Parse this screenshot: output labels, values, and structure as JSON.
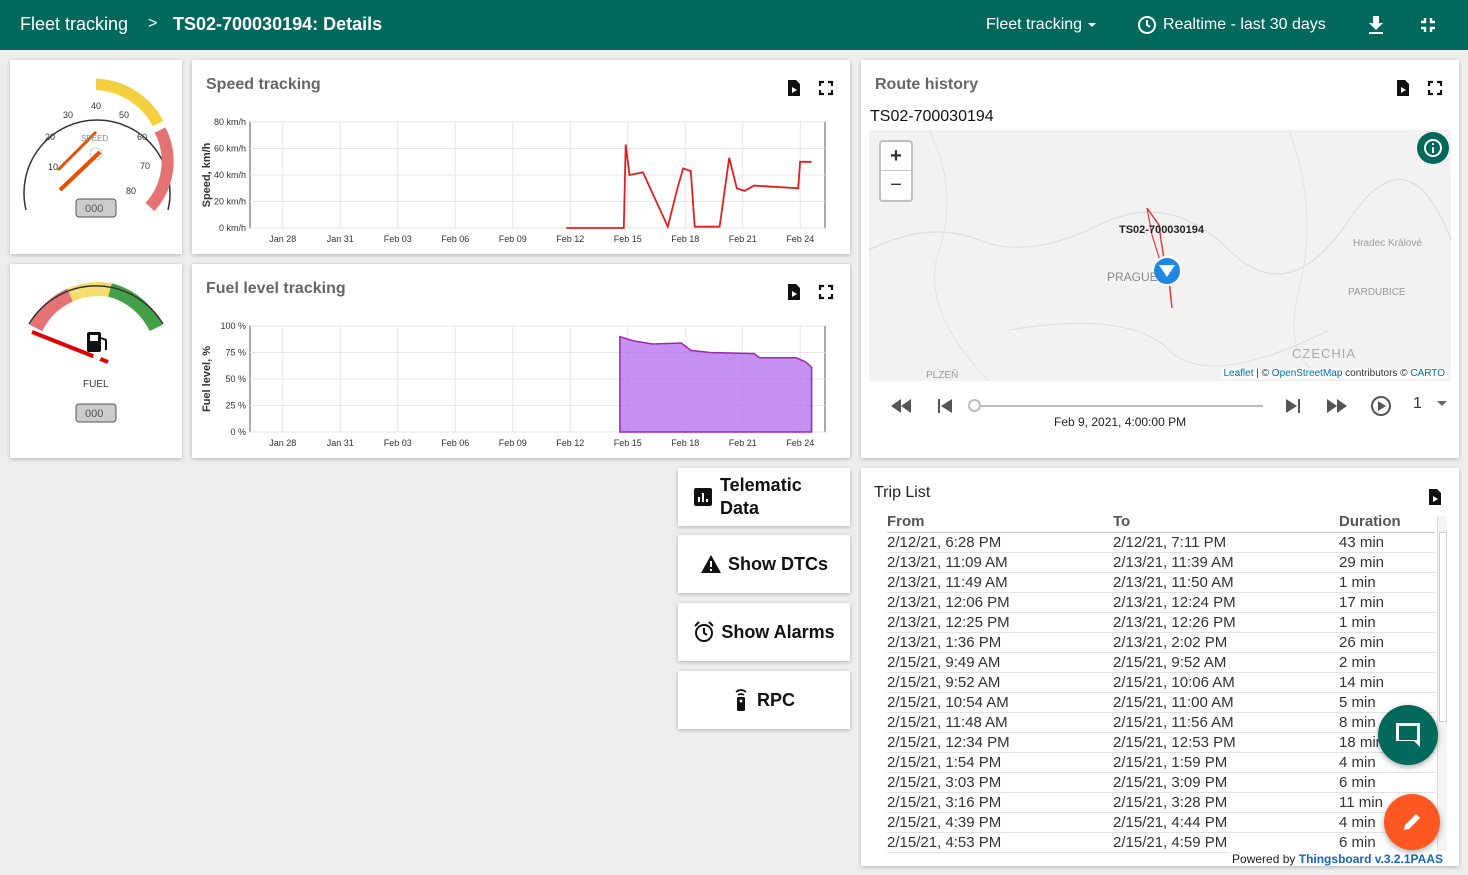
{
  "header": {
    "breadcrumb_root": "Fleet tracking",
    "breadcrumb_sep": ">",
    "breadcrumb_current": "TS02-700030194: Details",
    "state_select": "Fleet tracking",
    "timewindow": "Realtime - last 30 days"
  },
  "speed_gauge": {
    "label": "SPEED",
    "ticks": [
      "10",
      "20",
      "30",
      "40",
      "50",
      "60",
      "70",
      "80"
    ],
    "display": "000"
  },
  "fuel_gauge": {
    "label": "FUEL",
    "display": "000"
  },
  "speed_chart": {
    "title": "Speed tracking",
    "chart_data": {
      "type": "line",
      "ylabel": "Speed, km/h",
      "y_ticks": [
        "0 km/h",
        "20 km/h",
        "40 km/h",
        "60 km/h",
        "80 km/h"
      ],
      "ylim": [
        0,
        80
      ],
      "x_ticks": [
        "Jan 28",
        "Jan 31",
        "Feb 03",
        "Feb 06",
        "Feb 09",
        "Feb 12",
        "Feb 15",
        "Feb 18",
        "Feb 21",
        "Feb 24"
      ],
      "xlim": [
        0,
        30
      ],
      "series": [
        {
          "color": "#e02020",
          "points": [
            [
              16.5,
              0
            ],
            [
              19.5,
              0
            ],
            [
              19.6,
              63
            ],
            [
              19.8,
              40
            ],
            [
              20.5,
              42
            ],
            [
              21.8,
              1
            ],
            [
              22.3,
              30
            ],
            [
              22.6,
              45
            ],
            [
              23,
              43
            ],
            [
              23.2,
              1
            ],
            [
              24.5,
              1
            ],
            [
              25,
              53
            ],
            [
              25.4,
              30
            ],
            [
              25.8,
              28
            ],
            [
              26.3,
              32
            ],
            [
              28.6,
              30
            ],
            [
              28.7,
              50
            ],
            [
              29.3,
              50
            ]
          ]
        }
      ],
      "grid": true
    }
  },
  "fuel_chart": {
    "title": "Fuel level tracking",
    "chart_data": {
      "type": "area",
      "ylabel": "Fuel level, %",
      "y_ticks": [
        "0 %",
        "25 %",
        "50 %",
        "75 %",
        "100 %"
      ],
      "ylim": [
        0,
        100
      ],
      "x_ticks": [
        "Jan 28",
        "Jan 31",
        "Feb 03",
        "Feb 06",
        "Feb 09",
        "Feb 12",
        "Feb 15",
        "Feb 18",
        "Feb 21",
        "Feb 24"
      ],
      "xlim": [
        0,
        30
      ],
      "series": [
        {
          "color": "#b36bef",
          "points": [
            [
              19.3,
              90
            ],
            [
              20,
              86
            ],
            [
              21,
              83
            ],
            [
              22.5,
              84
            ],
            [
              23,
              77
            ],
            [
              24,
              75
            ],
            [
              26.3,
              74
            ],
            [
              26.6,
              70
            ],
            [
              28.5,
              70
            ],
            [
              29,
              66
            ],
            [
              29.3,
              61
            ]
          ]
        }
      ],
      "grid": true
    }
  },
  "route": {
    "title": "Route history",
    "device": "TS02-700030194",
    "map_labels": {
      "marker": "TS02-700030194",
      "prague": "PRAGUE",
      "hradec": "Hradec Králové",
      "pardubice": "PARDUBICE",
      "czechia": "CZECHIA",
      "plzen": "PLZEŇ"
    },
    "zoom_in": "+",
    "zoom_out": "−",
    "attribution_leaflet": "Leaflet",
    "attribution_sep1": " | © ",
    "attribution_osm": "OpenStreetMap",
    "attribution_mid": " contributors © ",
    "attribution_carto": "CARTO",
    "timestamp": "Feb 9, 2021, 4:00:00 PM",
    "speed_value": "1"
  },
  "buttons": {
    "telematic_line1": "Telematic",
    "telematic_line2": "Data",
    "dtcs": "Show DTCs",
    "alarms": "Show Alarms",
    "rpc": "RPC"
  },
  "trip_list": {
    "title": "Trip List",
    "columns": [
      "From",
      "To",
      "Duration"
    ],
    "rows": [
      [
        "2/12/21, 6:28 PM",
        "2/12/21, 7:11 PM",
        "43 min"
      ],
      [
        "2/13/21, 11:09 AM",
        "2/13/21, 11:39 AM",
        "29 min"
      ],
      [
        "2/13/21, 11:49 AM",
        "2/13/21, 11:50 AM",
        "1 min"
      ],
      [
        "2/13/21, 12:06 PM",
        "2/13/21, 12:24 PM",
        "17 min"
      ],
      [
        "2/13/21, 12:25 PM",
        "2/13/21, 12:26 PM",
        "1 min"
      ],
      [
        "2/13/21, 1:36 PM",
        "2/13/21, 2:02 PM",
        "26 min"
      ],
      [
        "2/15/21, 9:49 AM",
        "2/15/21, 9:52 AM",
        "2 min"
      ],
      [
        "2/15/21, 9:52 AM",
        "2/15/21, 10:06 AM",
        "14 min"
      ],
      [
        "2/15/21, 10:54 AM",
        "2/15/21, 11:00 AM",
        "5 min"
      ],
      [
        "2/15/21, 11:48 AM",
        "2/15/21, 11:56 AM",
        "8 min"
      ],
      [
        "2/15/21, 12:34 PM",
        "2/15/21, 12:53 PM",
        "18 min"
      ],
      [
        "2/15/21, 1:54 PM",
        "2/15/21, 1:59 PM",
        "4 min"
      ],
      [
        "2/15/21, 3:03 PM",
        "2/15/21, 3:09 PM",
        "6 min"
      ],
      [
        "2/15/21, 3:16 PM",
        "2/15/21, 3:28 PM",
        "11 min"
      ],
      [
        "2/15/21, 4:39 PM",
        "2/15/21, 4:44 PM",
        "4 min"
      ],
      [
        "2/15/21, 4:53 PM",
        "2/15/21, 4:59 PM",
        "6 min"
      ]
    ]
  },
  "footer": {
    "powered_by": "Powered by ",
    "link": "Thingsboard v.3.2.1PAAS"
  },
  "colors": {
    "primary": "#00695c",
    "speed_line": "#e02020",
    "fuel_fill": "#b36bef",
    "fab_edit": "#ff5722"
  }
}
